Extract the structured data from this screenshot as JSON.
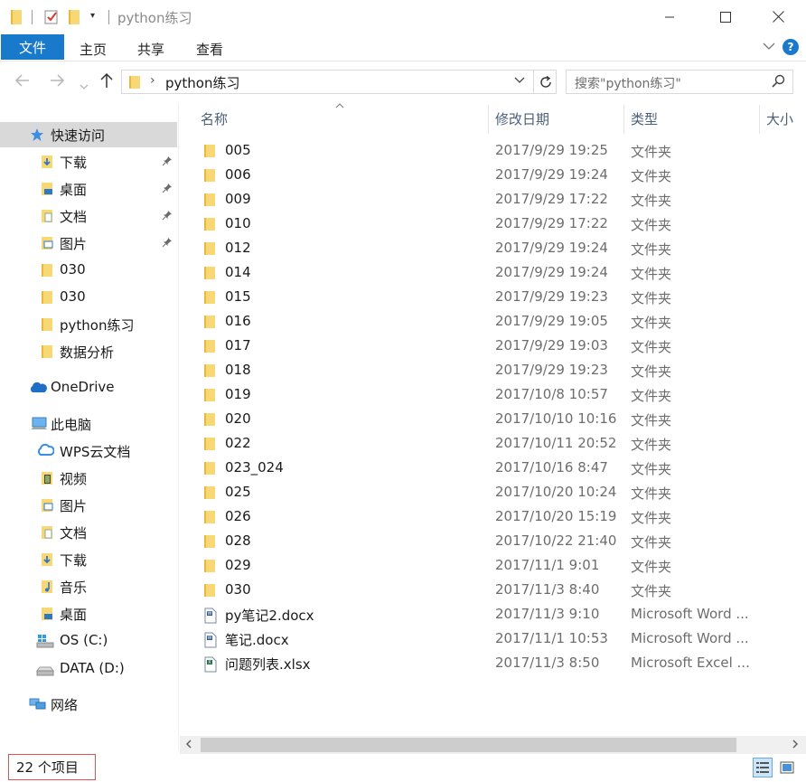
{
  "window": {
    "title": "python练习",
    "minimize_icon": "minimize-icon",
    "maximize_icon": "maximize-icon",
    "close_icon": "close-icon"
  },
  "ribbon": {
    "tabs": [
      {
        "label": "文件"
      },
      {
        "label": "主页"
      },
      {
        "label": "共享"
      },
      {
        "label": "查看"
      }
    ],
    "accent": "#1979ca"
  },
  "address": {
    "path": "python练习",
    "search_placeholder": "搜索\"python练习\""
  },
  "sidebar": {
    "items": [
      {
        "label": "快速访问",
        "icon": "star-icon",
        "selected": true
      },
      {
        "label": "下载",
        "icon": "download-folder-icon",
        "pinned": true
      },
      {
        "label": "桌面",
        "icon": "desktop-folder-icon",
        "pinned": true
      },
      {
        "label": "文档",
        "icon": "documents-folder-icon",
        "pinned": true
      },
      {
        "label": "图片",
        "icon": "pictures-folder-icon",
        "pinned": true
      },
      {
        "label": "030",
        "icon": "folder-icon"
      },
      {
        "label": "030",
        "icon": "folder-icon"
      },
      {
        "label": "python练习",
        "icon": "folder-icon"
      },
      {
        "label": "数据分析",
        "icon": "folder-icon"
      },
      {
        "label": "OneDrive",
        "icon": "cloud-icon"
      },
      {
        "label": "此电脑",
        "icon": "computer-icon"
      },
      {
        "label": "WPS云文档",
        "icon": "wps-cloud-icon"
      },
      {
        "label": "视频",
        "icon": "videos-folder-icon"
      },
      {
        "label": "图片",
        "icon": "pictures-folder-icon"
      },
      {
        "label": "文档",
        "icon": "documents-folder-icon"
      },
      {
        "label": "下载",
        "icon": "download-folder-icon"
      },
      {
        "label": "音乐",
        "icon": "music-folder-icon"
      },
      {
        "label": "桌面",
        "icon": "desktop-folder-icon"
      },
      {
        "label": "OS (C:)",
        "icon": "windows-drive-icon"
      },
      {
        "label": "DATA (D:)",
        "icon": "drive-icon"
      },
      {
        "label": "网络",
        "icon": "network-icon"
      }
    ]
  },
  "columns": {
    "name": "名称",
    "date": "修改日期",
    "type": "类型",
    "size": "大小"
  },
  "files": [
    {
      "name": "005",
      "date": "2017/9/29 19:25",
      "type": "文件夹",
      "icon": "folder-icon"
    },
    {
      "name": "006",
      "date": "2017/9/29 19:24",
      "type": "文件夹",
      "icon": "folder-icon"
    },
    {
      "name": "009",
      "date": "2017/9/29 17:22",
      "type": "文件夹",
      "icon": "folder-icon"
    },
    {
      "name": "010",
      "date": "2017/9/29 17:22",
      "type": "文件夹",
      "icon": "folder-icon"
    },
    {
      "name": "012",
      "date": "2017/9/29 19:24",
      "type": "文件夹",
      "icon": "folder-icon"
    },
    {
      "name": "014",
      "date": "2017/9/29 19:24",
      "type": "文件夹",
      "icon": "folder-icon"
    },
    {
      "name": "015",
      "date": "2017/9/29 19:23",
      "type": "文件夹",
      "icon": "folder-icon"
    },
    {
      "name": "016",
      "date": "2017/9/29 19:05",
      "type": "文件夹",
      "icon": "folder-icon"
    },
    {
      "name": "017",
      "date": "2017/9/29 19:03",
      "type": "文件夹",
      "icon": "folder-icon"
    },
    {
      "name": "018",
      "date": "2017/9/29 19:23",
      "type": "文件夹",
      "icon": "folder-icon"
    },
    {
      "name": "019",
      "date": "2017/10/8 10:57",
      "type": "文件夹",
      "icon": "folder-icon"
    },
    {
      "name": "020",
      "date": "2017/10/10 10:16",
      "type": "文件夹",
      "icon": "folder-icon"
    },
    {
      "name": "022",
      "date": "2017/10/11 20:52",
      "type": "文件夹",
      "icon": "folder-icon"
    },
    {
      "name": "023_024",
      "date": "2017/10/16 8:47",
      "type": "文件夹",
      "icon": "folder-icon"
    },
    {
      "name": "025",
      "date": "2017/10/20 10:24",
      "type": "文件夹",
      "icon": "folder-icon"
    },
    {
      "name": "026",
      "date": "2017/10/20 15:19",
      "type": "文件夹",
      "icon": "folder-icon"
    },
    {
      "name": "028",
      "date": "2017/10/22 21:40",
      "type": "文件夹",
      "icon": "folder-icon"
    },
    {
      "name": "029",
      "date": "2017/11/1 9:01",
      "type": "文件夹",
      "icon": "folder-icon"
    },
    {
      "name": "030",
      "date": "2017/11/3 8:40",
      "type": "文件夹",
      "icon": "folder-icon"
    },
    {
      "name": "py笔记2.docx",
      "date": "2017/11/3 9:10",
      "type": "Microsoft Word ...",
      "icon": "word-doc-icon"
    },
    {
      "name": "笔记.docx",
      "date": "2017/11/1 10:53",
      "type": "Microsoft Word ...",
      "icon": "word-doc-icon"
    },
    {
      "name": "问题列表.xlsx",
      "date": "2017/11/3 8:50",
      "type": "Microsoft Excel ...",
      "icon": "excel-doc-icon"
    }
  ],
  "status": {
    "item_count": "22 个项目"
  },
  "colors": {
    "folder": "#f8d775",
    "folder_dark": "#e8b93e",
    "selection": "#d9d9d9",
    "status_highlight": "#e35050"
  }
}
